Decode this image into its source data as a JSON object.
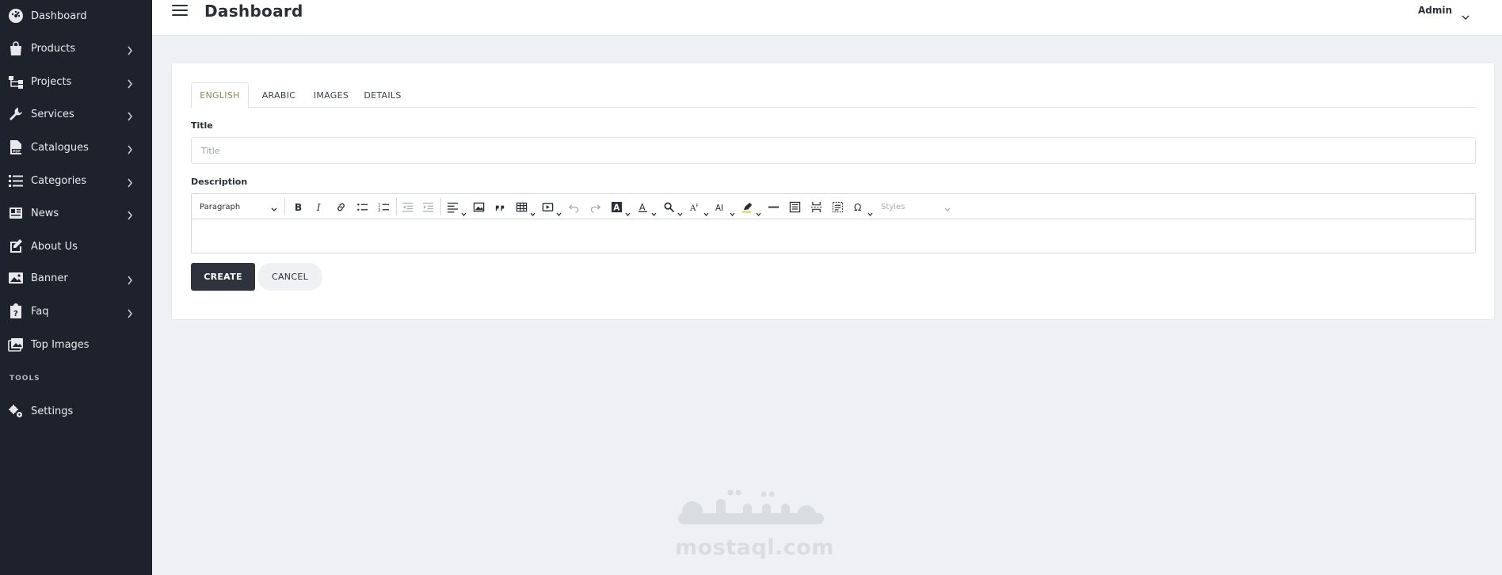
{
  "sidebar": {
    "items": [
      {
        "label": "Dashboard",
        "icon": "dashboard-icon",
        "has_submenu": false
      },
      {
        "label": "Products",
        "icon": "shopping-bag-icon",
        "has_submenu": true
      },
      {
        "label": "Projects",
        "icon": "sitemap-icon",
        "has_submenu": true
      },
      {
        "label": "Services",
        "icon": "wrench-icon",
        "has_submenu": true
      },
      {
        "label": "Catalogues",
        "icon": "pdf-file-icon",
        "has_submenu": true
      },
      {
        "label": "Categories",
        "icon": "list-icon",
        "has_submenu": true
      },
      {
        "label": "News",
        "icon": "newspaper-icon",
        "has_submenu": true
      },
      {
        "label": "About Us",
        "icon": "edit-icon",
        "has_submenu": false
      },
      {
        "label": "Banner",
        "icon": "image-icon",
        "has_submenu": true
      },
      {
        "label": "Faq",
        "icon": "question-clipboard-icon",
        "has_submenu": true
      },
      {
        "label": "Top Images",
        "icon": "images-icon",
        "has_submenu": false
      }
    ],
    "tools_heading": "TOOLS",
    "tools_items": [
      {
        "label": "Settings",
        "icon": "gears-icon",
        "has_submenu": false
      }
    ]
  },
  "header": {
    "title": "Dashboard",
    "user_name": "Admin"
  },
  "form": {
    "tabs": [
      {
        "label": "ENGLISH",
        "active": true
      },
      {
        "label": "ARABIC",
        "active": false
      },
      {
        "label": "IMAGES",
        "active": false
      },
      {
        "label": "DETAILS",
        "active": false
      }
    ],
    "title_label": "Title",
    "title_placeholder": "Title",
    "title_value": "",
    "description_label": "Description",
    "editor": {
      "heading_select": "Paragraph",
      "styles_select": "Styles",
      "content": ""
    },
    "create_label": "CREATE",
    "cancel_label": "CANCEL"
  },
  "watermark": {
    "arabic_text": "مستقل",
    "latin_text": "mostaql.com"
  },
  "colors": {
    "sidebar_bg": "#1e222d",
    "page_bg": "#eef0f3",
    "active_tab_text": "#8a8b55",
    "primary_button": "#2f333d"
  }
}
